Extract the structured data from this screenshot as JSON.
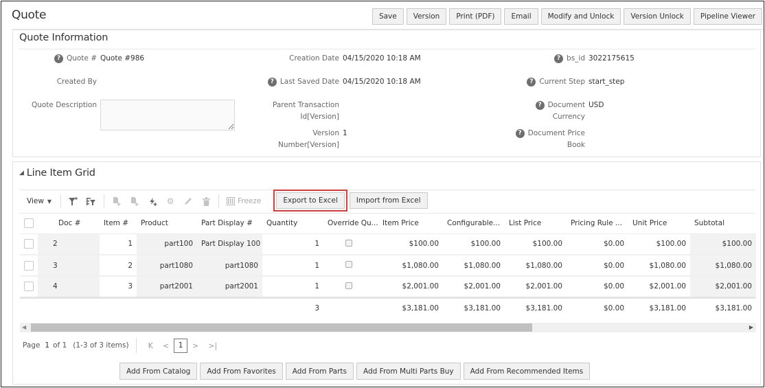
{
  "header": {
    "title": "Quote",
    "actions": [
      "Save",
      "Version",
      "Print (PDF)",
      "Email",
      "Modify and Unlock",
      "Version Unlock",
      "Pipeline Viewer"
    ]
  },
  "quote_info": {
    "title": "Quote Information",
    "fields": {
      "quote_num": {
        "label": "Quote #",
        "value": "Quote #986",
        "help": true
      },
      "created_by": {
        "label": "Created By",
        "value": ""
      },
      "quote_description": {
        "label": "Quote Description",
        "value": ""
      },
      "creation_date": {
        "label": "Creation Date",
        "value": "04/15/2020 10:18 AM"
      },
      "last_saved_date": {
        "label": "Last Saved Date",
        "value": "04/15/2020 10:18 AM",
        "help": true
      },
      "parent_transaction": {
        "label_line1": "Parent Transaction",
        "label_line2": "Id[Version]",
        "value": ""
      },
      "version_number": {
        "label_line1": "Version",
        "label_line2": "Number[Version]",
        "value": "1"
      },
      "bs_id": {
        "label": "bs_id",
        "value": "3022175615",
        "help": true
      },
      "current_step": {
        "label": "Current Step",
        "value": "start_step",
        "help": true
      },
      "document_currency": {
        "label_line1": "Document",
        "label_line2": "Currency",
        "value": "USD",
        "help": true
      },
      "document_price_book": {
        "label_line1": "Document Price",
        "label_line2": "Book",
        "value": "",
        "help": true
      }
    }
  },
  "line_item_grid": {
    "title": "Line Item Grid",
    "toolbar": {
      "view_label": "View",
      "freeze_label": "Freeze",
      "export_label": "Export to Excel",
      "import_label": "Import from Excel"
    },
    "columns": [
      "Doc #",
      "Item #",
      "Product",
      "Part Display #",
      "Quantity",
      "Override Qu...",
      "Item Price",
      "Configurable...",
      "List Price",
      "Pricing Rule ...",
      "Unit Price",
      "Subtotal"
    ],
    "rows": [
      {
        "doc": "2",
        "item": "1",
        "product": "part100",
        "part_display": "Part Display 100",
        "quantity": "1",
        "override": false,
        "item_price": "$100.00",
        "configurable": "$100.00",
        "list_price": "$100.00",
        "pricing_rule": "$0.00",
        "unit_price": "$100.00",
        "subtotal": "$100.00"
      },
      {
        "doc": "3",
        "item": "2",
        "product": "part1080",
        "part_display": "part1080",
        "quantity": "1",
        "override": false,
        "item_price": "$1,080.00",
        "configurable": "$1,080.00",
        "list_price": "$1,080.00",
        "pricing_rule": "$0.00",
        "unit_price": "$1,080.00",
        "subtotal": "$1,080.00"
      },
      {
        "doc": "4",
        "item": "3",
        "product": "part2001",
        "part_display": "part2001",
        "quantity": "1",
        "override": false,
        "item_price": "$2,001.00",
        "configurable": "$2,001.00",
        "list_price": "$2,001.00",
        "pricing_rule": "$0.00",
        "unit_price": "$2,001.00",
        "subtotal": "$2,001.00"
      }
    ],
    "totals": {
      "quantity": "3",
      "item_price": "$3,181.00",
      "configurable": "$3,181.00",
      "list_price": "$3,181.00",
      "pricing_rule": "$0.00",
      "unit_price": "$3,181.00",
      "subtotal": "$3,181.00"
    },
    "pager": {
      "page_label": "Page",
      "page": "1",
      "of_label": "of 1",
      "range": "(1-3 of 3 items)",
      "current_page": "1"
    },
    "add_actions": [
      "Add From Catalog",
      "Add From Favorites",
      "Add From Parts",
      "Add From Multi Parts Buy",
      "Add From Recommended Items"
    ]
  },
  "colors": {
    "highlight_border": "#e53935",
    "button_bg": "#f1f1f1",
    "help_icon": "#6e6e6e"
  }
}
